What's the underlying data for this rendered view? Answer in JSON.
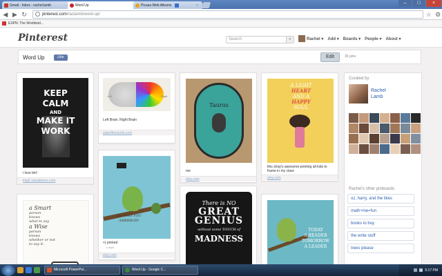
{
  "browser": {
    "tabs": [
      {
        "label": "Gmail - Inbox - rachel.lamb",
        "favicon_color": "#c33a2b",
        "active": false
      },
      {
        "label": "Word Up",
        "favicon_color": "#c8232c",
        "active": true
      },
      {
        "label": "Picasa Web Albums - Rach",
        "favicon_color": "#e8a317",
        "active": false
      },
      {
        "label": "",
        "favicon_color": "#3b6fc8",
        "active": false
      }
    ],
    "url_host": "pinterest.com",
    "url_path": "/raclamb/word-up/",
    "bookmarks": [
      {
        "label": "ESPN: The Worldwid..."
      }
    ]
  },
  "header": {
    "logo": "Pinterest",
    "search_placeholder": "Search",
    "nav": [
      {
        "label": "Rachel",
        "has_dropdown": true
      },
      {
        "label": "Add",
        "has_dropdown": true
      },
      {
        "label": "Boards",
        "has_dropdown": true
      },
      {
        "label": "People",
        "has_dropdown": true
      },
      {
        "label": "About",
        "has_dropdown": true
      }
    ]
  },
  "board": {
    "title": "Word Up",
    "like_label": "Like",
    "edit_label": "Edit",
    "pin_count": "36 pins"
  },
  "pins": [
    {
      "art_text": [
        "KEEP",
        "CALM",
        "AND",
        "MAKE IT",
        "WORK"
      ],
      "caption": "i love tim!",
      "source": "img2.visualizeus.com",
      "bg": "#1a1a1a",
      "fg": "#ffffff"
    },
    {
      "art_text": [
        "Left",
        "Right"
      ],
      "caption": "Left Brain. Right Brain",
      "source": "adaoftheworld.com",
      "bg": "#f1eee8",
      "fg": "#777777"
    },
    {
      "art_text": [
        "Taurus"
      ],
      "caption": "me",
      "source": "etsy.com",
      "bg": "#3aa39a",
      "fg": "#2a2a2a"
    },
    {
      "art_text": [
        "A LIGHT",
        "HEART",
        "AND A",
        "HAPPY",
        "SOUL"
      ],
      "caption": "this shop's awesome-printing all kids to frame in my class",
      "source": "etsy.com",
      "bg": "#f3d05a",
      "fg": "#ffffff"
    },
    {
      "art_text": [
        "BE WHO YOU",
        "ARRRRGH!"
      ],
      "caption": "+) printed",
      "meta": "1 repin",
      "source": "etsy.com",
      "bg": "#7ec4d4",
      "fg": "#4a3a2a"
    },
    {
      "art_text": [
        "a Smart",
        "person",
        "knows",
        "what to say",
        "a Wise",
        "person",
        "knows",
        "whether or not",
        "to say it."
      ],
      "bg": "#fbfaf6",
      "fg": "#444444"
    },
    {
      "art_text": [
        "There is NO",
        "GREAT",
        "GENIUS",
        "without some TOUCH of",
        "MADNESS"
      ],
      "bg": "#161616",
      "fg": "#ffffff"
    },
    {
      "art_text": [
        "TODAY",
        "A READER",
        "TOMORROW",
        "A LEADER"
      ],
      "bg": "#6cb8c4",
      "fg": "#ffffff"
    }
  ],
  "sidebar": {
    "curated_by_label": "Curated by",
    "curator_name": "Rachel Lamb",
    "follower_colors": [
      "#7a5a48",
      "#c49a7a",
      "#3c4a5a",
      "#d4b090",
      "#8a6048",
      "#5a7a9a",
      "#2a2a2a",
      "#b08868",
      "#6a4a3a",
      "#d8c0a8",
      "#4a5a6a",
      "#a07858",
      "#7a8a9a",
      "#caa080",
      "#9a7050",
      "#e0c8b0",
      "#5a4030",
      "#b8a090",
      "#3a3a4a",
      "#c8a078",
      "#8090a0",
      "#d0b098",
      "#6a5040",
      "#a08070",
      "#4a6a8a",
      "#e8d0b8",
      "#7a6050",
      "#b09080"
    ],
    "other_boards_label": "Rachel's other pinboards",
    "other_boards": [
      {
        "label": "oz, harry, and the likes"
      },
      {
        "label": "math+me=fun"
      },
      {
        "label": "books to buy"
      },
      {
        "label": "the write stuff"
      },
      {
        "label": "trees please"
      }
    ]
  },
  "taskbar": {
    "tasks": [
      {
        "label": "Microsoft PowerPoi...",
        "icon_color": "#d2542a"
      },
      {
        "label": "Word Up - Google C...",
        "icon_color": "#3b8a3b"
      }
    ],
    "clock": "5:17 PM"
  }
}
